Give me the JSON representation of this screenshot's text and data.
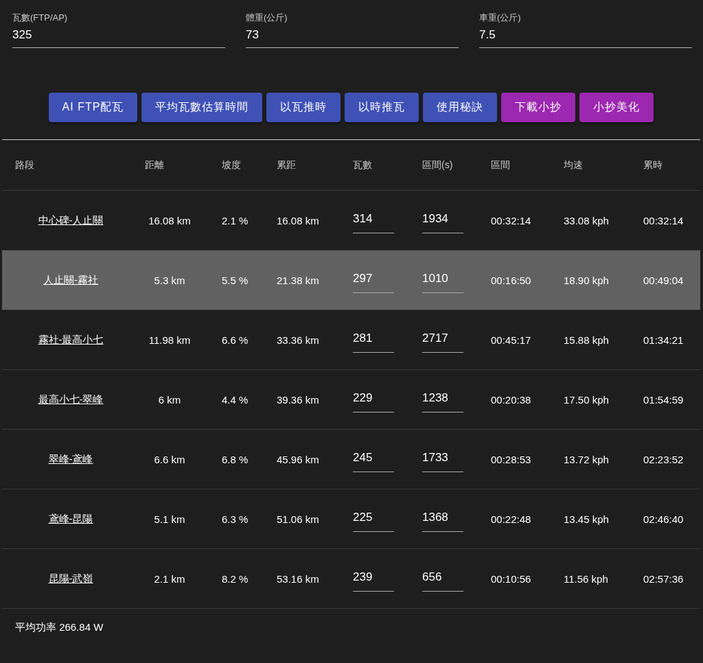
{
  "fields": [
    {
      "label": "瓦數(FTP/AP)",
      "value": "325"
    },
    {
      "label": "體重(公斤)",
      "value": "73"
    },
    {
      "label": "車重(公斤)",
      "value": "7.5"
    }
  ],
  "buttons": [
    {
      "label": "AI FTP配瓦",
      "kind": "primary"
    },
    {
      "label": "平均瓦數估算時間",
      "kind": "primary"
    },
    {
      "label": "以瓦推時",
      "kind": "primary"
    },
    {
      "label": "以時推瓦",
      "kind": "primary"
    },
    {
      "label": "使用秘訣",
      "kind": "primary"
    },
    {
      "label": "下載小抄",
      "kind": "accent"
    },
    {
      "label": "小抄美化",
      "kind": "accent"
    }
  ],
  "table": {
    "columns": [
      "路段",
      "距離",
      "坡度",
      "累距",
      "瓦數",
      "區間(s)",
      "區間",
      "均速",
      "累時"
    ],
    "rows": [
      {
        "selected": false,
        "segment": "中心碑-人止關",
        "distance": "16.08 km",
        "grade": "2.1 %",
        "cumulative_distance": "16.08 km",
        "watts": "314",
        "interval_s": "1934",
        "interval": "00:32:14",
        "avg_speed": "33.08 kph",
        "cumulative_time": "00:32:14"
      },
      {
        "selected": true,
        "segment": "人止關-霧社",
        "distance": "5.3 km",
        "grade": "5.5 %",
        "cumulative_distance": "21.38 km",
        "watts": "297",
        "interval_s": "1010",
        "interval": "00:16:50",
        "avg_speed": "18.90 kph",
        "cumulative_time": "00:49:04"
      },
      {
        "selected": false,
        "segment": "霧社-最高小七",
        "distance": "11.98 km",
        "grade": "6.6 %",
        "cumulative_distance": "33.36 km",
        "watts": "281",
        "interval_s": "2717",
        "interval": "00:45:17",
        "avg_speed": "15.88 kph",
        "cumulative_time": "01:34:21"
      },
      {
        "selected": false,
        "segment": "最高小七-翠峰",
        "distance": "6 km",
        "grade": "4.4 %",
        "cumulative_distance": "39.36 km",
        "watts": "229",
        "interval_s": "1238",
        "interval": "00:20:38",
        "avg_speed": "17.50 kph",
        "cumulative_time": "01:54:59"
      },
      {
        "selected": false,
        "segment": "翠峰-鳶峰",
        "distance": "6.6 km",
        "grade": "6.8 %",
        "cumulative_distance": "45.96 km",
        "watts": "245",
        "interval_s": "1733",
        "interval": "00:28:53",
        "avg_speed": "13.72 kph",
        "cumulative_time": "02:23:52"
      },
      {
        "selected": false,
        "segment": "鳶峰-昆陽",
        "distance": "5.1 km",
        "grade": "6.3 %",
        "cumulative_distance": "51.06 km",
        "watts": "225",
        "interval_s": "1368",
        "interval": "00:22:48",
        "avg_speed": "13.45 kph",
        "cumulative_time": "02:46:40"
      },
      {
        "selected": false,
        "segment": "昆陽-武嶺",
        "distance": "2.1 km",
        "grade": "8.2 %",
        "cumulative_distance": "53.16 km",
        "watts": "239",
        "interval_s": "656",
        "interval": "00:10:56",
        "avg_speed": "11.56 kph",
        "cumulative_time": "02:57:36"
      }
    ]
  },
  "footer": "平均功率 266.84 W"
}
